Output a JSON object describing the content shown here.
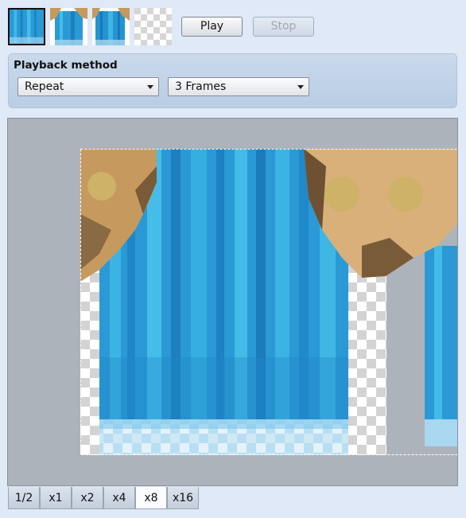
{
  "frames": [
    {
      "name": "frame-1-thumbnail",
      "selected": true
    },
    {
      "name": "frame-2-thumbnail",
      "selected": false
    },
    {
      "name": "frame-3-thumbnail",
      "selected": false
    },
    {
      "name": "frame-4-thumbnail-empty",
      "selected": false
    }
  ],
  "toolbar": {
    "play_label": "Play",
    "stop_label": "Stop",
    "stop_disabled": true
  },
  "playback": {
    "title": "Playback method",
    "method_selected": "Repeat",
    "frames_selected": "3 Frames"
  },
  "preview": {
    "content": "waterfall-tile-with-rocks",
    "background": "transparency-checkerboard",
    "selection": "dashed"
  },
  "zoom": {
    "tabs": [
      "1/2",
      "x1",
      "x2",
      "x4",
      "x8",
      "x16"
    ],
    "active": "x8"
  },
  "colors": {
    "background": "#dfe9f7",
    "panel": "#c2d4ea",
    "canvas": "#adb3bb",
    "water_dark": "#1f88c8",
    "water_light": "#3fb6e4",
    "rock_light": "#dcb27a",
    "rock_dark": "#6e5132"
  }
}
